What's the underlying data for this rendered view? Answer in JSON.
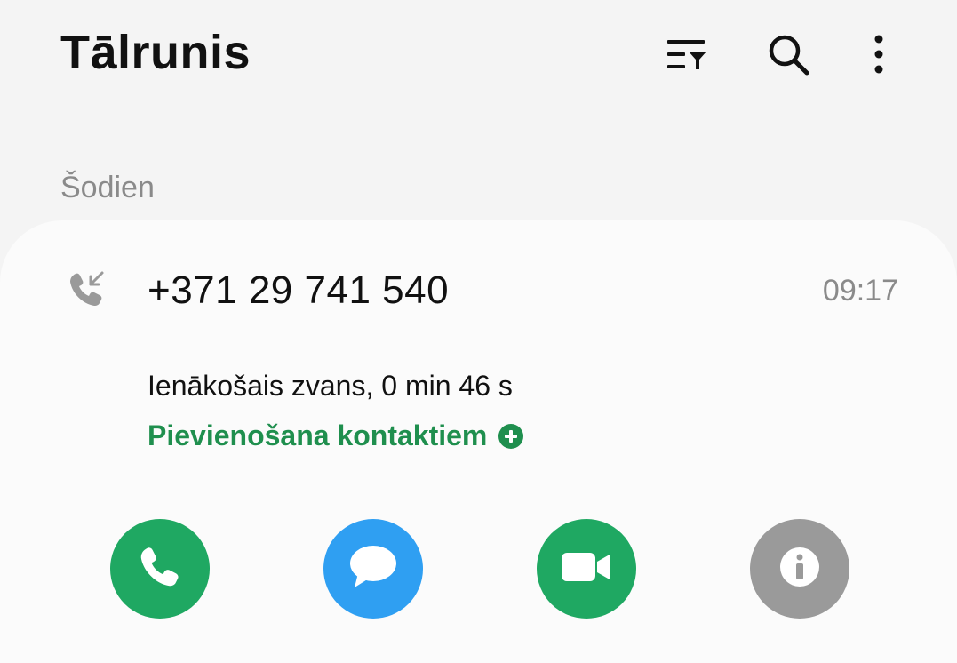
{
  "header": {
    "title": "Tālrunis",
    "icons": [
      "filter-icon",
      "search-icon",
      "more-vert-icon"
    ]
  },
  "section": {
    "label": "Šodien"
  },
  "call": {
    "number": "+371 29 741 540",
    "time": "09:17",
    "details": "Ienākošais zvans, 0 min 46 s",
    "add_contact_label": "Pievienošana kontaktiem",
    "type_icon": "incoming-call-icon"
  },
  "actions": [
    {
      "name": "call",
      "icon": "phone-icon",
      "color": "#1fa862"
    },
    {
      "name": "message",
      "icon": "message-bubble-icon",
      "color": "#2f9ff2"
    },
    {
      "name": "video-call",
      "icon": "video-camera-icon",
      "color": "#1fa862"
    },
    {
      "name": "info",
      "icon": "info-icon",
      "color": "#9a9a9a"
    }
  ],
  "colors": {
    "background": "#f4f4f4",
    "card": "#fbfbfb",
    "accent_green": "#1f8f4e",
    "muted_text": "#8a8a8a"
  }
}
